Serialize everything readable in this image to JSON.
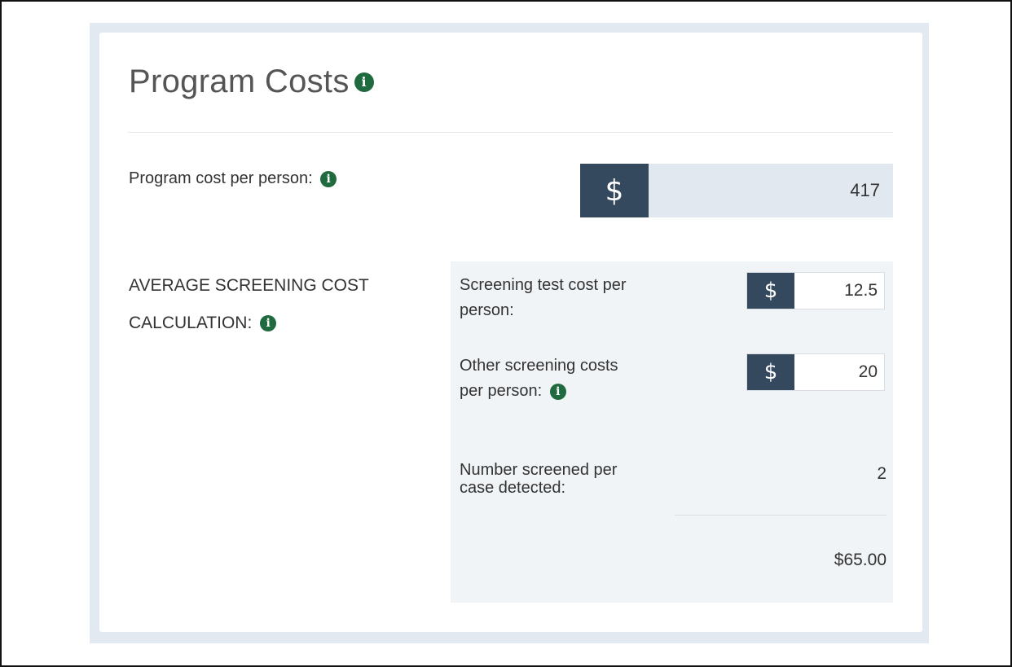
{
  "section": {
    "title": "Program Costs"
  },
  "program_cost": {
    "label": "Program cost per person:",
    "currency": "$",
    "value": "417"
  },
  "average_screening": {
    "label_line1": "AVERAGE SCREENING COST",
    "label_line2": "CALCULATION:",
    "test_cost": {
      "label_line1": "Screening test cost per",
      "label_line2": "person:",
      "currency": "$",
      "value": "12.5"
    },
    "other_costs": {
      "label_line1": "Other screening costs",
      "label_line2": "per person:",
      "currency": "$",
      "value": "20"
    },
    "number_screened": {
      "label_line1": "Number screened per",
      "label_line2": "case detected:",
      "value": "2"
    },
    "total": "$65.00"
  },
  "icons": {
    "info": "info-icon"
  },
  "colors": {
    "currency_box": "#34495e",
    "info_icon": "#1f6b3f",
    "panel_background": "#e2e9f1"
  }
}
